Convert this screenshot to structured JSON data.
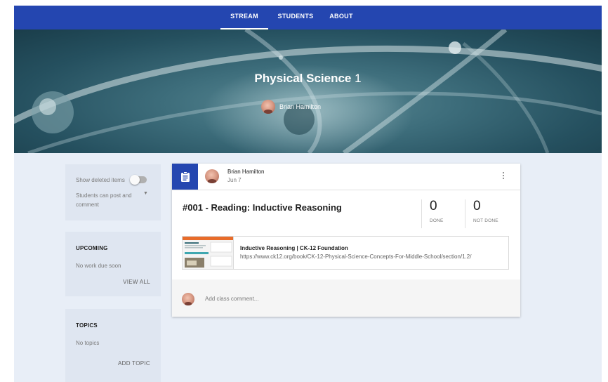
{
  "nav": {
    "tabs": [
      "STREAM",
      "STUDENTS",
      "ABOUT"
    ],
    "active": "STREAM"
  },
  "header": {
    "course_title": "Physical Science",
    "course_number": "1",
    "teacher_name": "Brian Hamilton"
  },
  "sidebar": {
    "settings": {
      "show_deleted_label": "Show deleted items",
      "show_deleted_on": false,
      "post_permission_line1": "Students can post and",
      "post_permission_line2": "comment"
    },
    "upcoming": {
      "heading": "UPCOMING",
      "message": "No work due soon",
      "action": "VIEW ALL"
    },
    "topics": {
      "heading": "TOPICS",
      "message": "No topics",
      "action": "ADD TOPIC"
    }
  },
  "post": {
    "author": "Brian Hamilton",
    "date": "Jun 7",
    "title": "#001 - Reading: Inductive Reasoning",
    "done_count": "0",
    "done_label": "DONE",
    "not_done_count": "0",
    "not_done_label": "NOT DONE",
    "attachment": {
      "title": "Inductive Reasoning | CK-12 Foundation",
      "url": "https://www.ck12.org/book/CK-12-Physical-Science-Concepts-For-Middle-School/section/1.2/"
    },
    "comment_placeholder": "Add class comment..."
  },
  "colors": {
    "brand": "#2446b0",
    "background": "#e8eef7",
    "sidebar_card": "#dfe6f1"
  },
  "icons": {
    "assignment": "assignment-icon",
    "more": "more-vert-icon",
    "dropdown": "dropdown-arrow-icon"
  }
}
